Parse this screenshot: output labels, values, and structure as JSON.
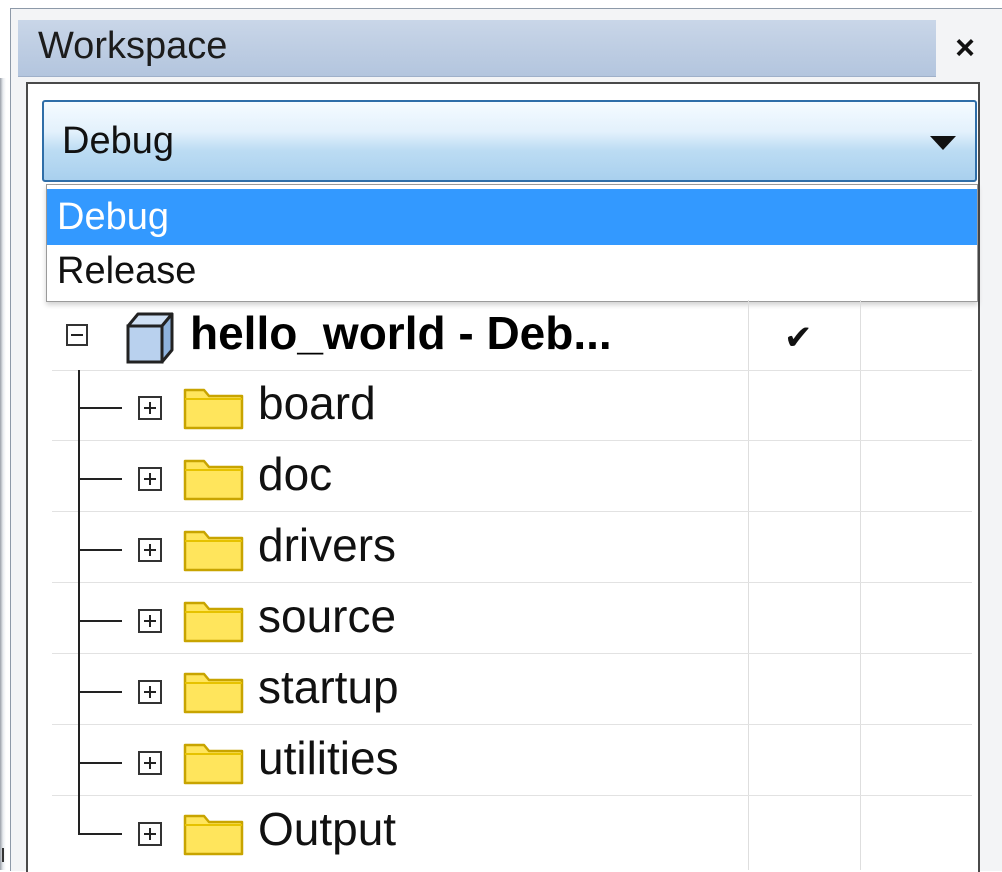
{
  "panel": {
    "title": "Workspace",
    "close_label": "×"
  },
  "configuration": {
    "selected": "Debug",
    "options": [
      "Debug",
      "Release"
    ],
    "highlighted_option": "Debug"
  },
  "tree": {
    "project": {
      "label": "hello_world - Deb...",
      "active_mark": "✔"
    },
    "folders": [
      {
        "label": "board"
      },
      {
        "label": "doc"
      },
      {
        "label": "drivers"
      },
      {
        "label": "source"
      },
      {
        "label": "startup"
      },
      {
        "label": "utilities"
      },
      {
        "label": "Output"
      }
    ]
  },
  "colors": {
    "title_bar": "#b3c5de",
    "combo_border": "#2f6ea8",
    "selection": "#3399ff",
    "folder_fill": "#ffe55c",
    "folder_outline": "#c8a400"
  },
  "icons": {
    "project": "project-cube-icon",
    "folder": "folder-icon",
    "expand": "plus-box-icon",
    "collapse": "minus-box-icon",
    "dropdown": "triangle-down-icon",
    "close": "close-icon"
  }
}
